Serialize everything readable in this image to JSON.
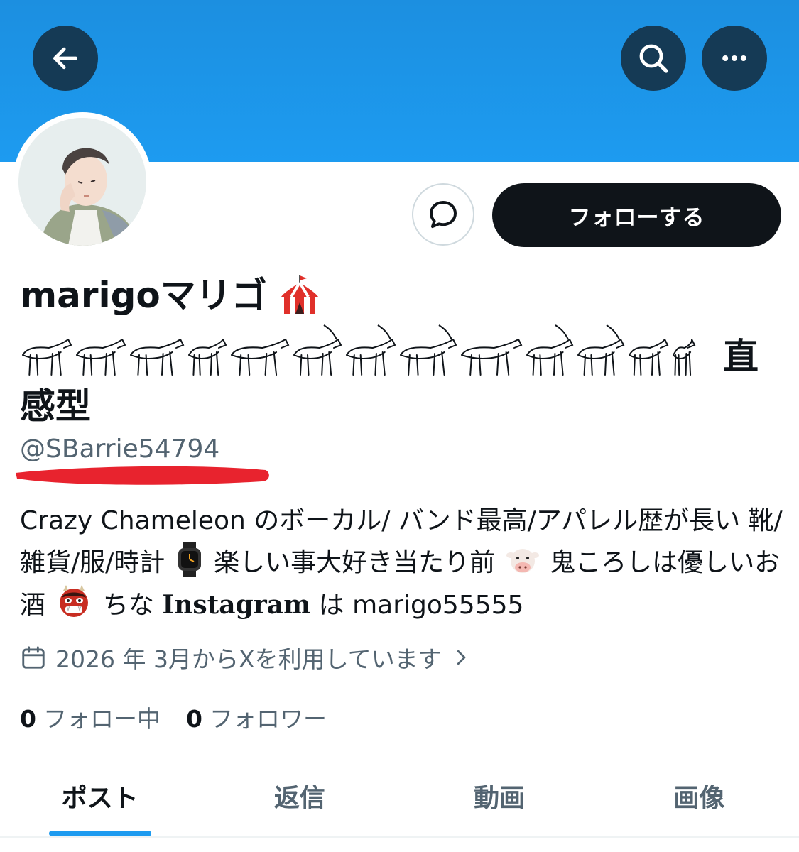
{
  "header": {
    "back_icon": "arrow-left-icon",
    "search_icon": "search-icon",
    "more_icon": "more-horizontal-icon",
    "banner_color": "#1d9bf0"
  },
  "profile": {
    "display_name": "marigoマリゴ",
    "name_emoji": "circus-tent-icon",
    "name_animals": [
      "lion-icon",
      "ox-icon",
      "boar-icon",
      "cat-icon",
      "rabbit-icon",
      "gazelle-icon",
      "ibex-icon",
      "oryx-icon",
      "hippo-icon",
      "donkey-icon",
      "deer-icon",
      "man-icon",
      "horse-icon"
    ],
    "name_tail": "直",
    "name_line3": "感型",
    "handle": "@SBarrie54794",
    "bio": {
      "part1": "Crazy Chameleon のボーカル/ バンド最高/アパレル歴が長い 靴/雑貨/服/時計",
      "emoji1": "watch-icon",
      "part2": "楽しい事大好き当たり前",
      "emoji2": "cow-icon",
      "part3": "鬼ころしは優しいお酒",
      "emoji3": "oni-icon",
      "part4": "ちな",
      "instagram_word": "Instagram",
      "part5": "は marigo55555"
    },
    "joined": "2026 年 3月からXを利用しています",
    "calendar_icon": "calendar-icon",
    "following_count": "0",
    "following_label": "フォロー中",
    "followers_count": "0",
    "followers_label": "フォロワー"
  },
  "actions": {
    "follow_label": "フォローする",
    "dm_icon": "message-icon"
  },
  "tabs": [
    {
      "label": "ポスト",
      "active": true
    },
    {
      "label": "返信",
      "active": false
    },
    {
      "label": "動画",
      "active": false
    },
    {
      "label": "画像",
      "active": false
    }
  ],
  "colors": {
    "accent": "#1d9bf0",
    "annotation_red": "#e8232e",
    "text_secondary": "#536471"
  }
}
